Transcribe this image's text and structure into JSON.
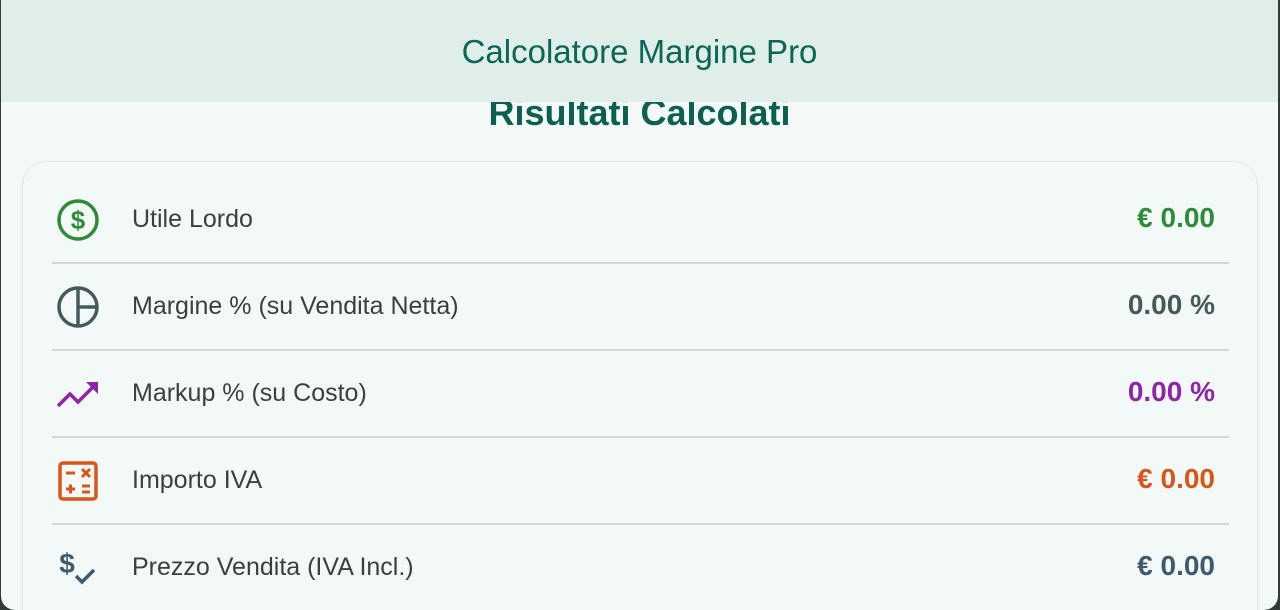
{
  "app": {
    "title": "Calcolatore Margine Pro"
  },
  "section": {
    "title": "Risultati Calcolati"
  },
  "results": [
    {
      "label": "Utile Lordo",
      "value": "€ 0.00",
      "icon": "dollar-circle-icon",
      "color": "#2e8b3a"
    },
    {
      "label": "Margine % (su Vendita Netta)",
      "value": "0.00 %",
      "icon": "pie-chart-icon",
      "color": "#455a5a"
    },
    {
      "label": "Markup % (su Costo)",
      "value": "0.00 %",
      "icon": "trending-up-icon",
      "color": "#8e24aa"
    },
    {
      "label": "Importo IVA",
      "value": "€ 0.00",
      "icon": "calculator-icon",
      "color": "#d9561b"
    },
    {
      "label": "Prezzo Vendita (IVA Incl.)",
      "value": "€ 0.00",
      "icon": "price-check-icon",
      "color": "#3e5a6e"
    }
  ]
}
